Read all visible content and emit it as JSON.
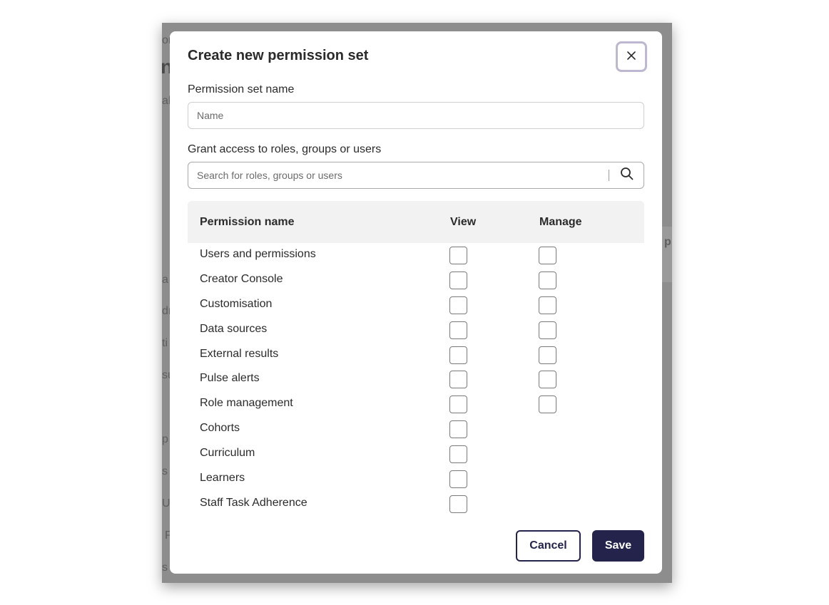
{
  "background_app": {
    "fragments": [
      "or",
      "n",
      "al",
      "p",
      "a",
      "dr",
      "ti",
      "su",
      "p",
      "s",
      "U",
      "P",
      "s"
    ]
  },
  "modal": {
    "title": "Create new permission set",
    "close_icon": "close-icon",
    "name_field": {
      "label": "Permission set name",
      "placeholder": "Name",
      "value": ""
    },
    "grant_field": {
      "label": "Grant access to roles, groups or users",
      "placeholder": "Search for roles, groups or users",
      "value": "",
      "icon": "search-icon"
    },
    "table": {
      "columns": [
        "Permission name",
        "View",
        "Manage"
      ],
      "rows": [
        {
          "name": "Users and permissions",
          "view": false,
          "manage": false,
          "has_manage": true
        },
        {
          "name": "Creator Console",
          "view": false,
          "manage": false,
          "has_manage": true
        },
        {
          "name": "Customisation",
          "view": false,
          "manage": false,
          "has_manage": true
        },
        {
          "name": "Data sources",
          "view": false,
          "manage": false,
          "has_manage": true
        },
        {
          "name": "External results",
          "view": false,
          "manage": false,
          "has_manage": true
        },
        {
          "name": "Pulse alerts",
          "view": false,
          "manage": false,
          "has_manage": true
        },
        {
          "name": "Role management",
          "view": false,
          "manage": false,
          "has_manage": true
        },
        {
          "name": "Cohorts",
          "view": false,
          "has_manage": false
        },
        {
          "name": "Curriculum",
          "view": false,
          "has_manage": false
        },
        {
          "name": "Learners",
          "view": false,
          "has_manage": false
        },
        {
          "name": "Staff Task Adherence",
          "view": false,
          "has_manage": false
        }
      ]
    },
    "buttons": {
      "cancel": "Cancel",
      "save": "Save"
    }
  },
  "colors": {
    "primary": "#24234c",
    "close_border": "#bdb8d0",
    "header_bg": "#f2f2f2",
    "backdrop": "#8d8d8d"
  }
}
